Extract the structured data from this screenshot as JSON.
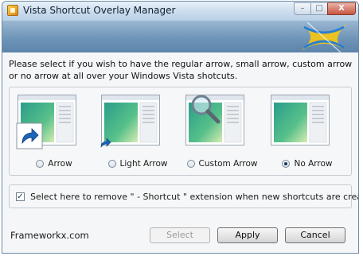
{
  "window": {
    "title": "Vista Shortcut Overlay Manager",
    "controls": {
      "minimize": "–",
      "maximize": "□",
      "close": "X"
    }
  },
  "prompt": "Please select if you wish to have the regular arrow, small arrow, custom arrow or no arrow at all over your Windows Vista shotcuts.",
  "options": [
    {
      "label": "Arrow",
      "selected": false,
      "overlay": "large-arrow-icon"
    },
    {
      "label": "Light Arrow",
      "selected": false,
      "overlay": "small-arrow-icon"
    },
    {
      "label": "Custom Arrow",
      "selected": false,
      "overlay": "magnifier-icon"
    },
    {
      "label": "No Arrow",
      "selected": true,
      "overlay": "none"
    }
  ],
  "remove_extension": {
    "checked": true,
    "label": "Select here to remove \" - Shortcut \" extension when new shortcuts are created."
  },
  "footer": {
    "link": "Frameworkx.com"
  },
  "buttons": {
    "select": {
      "label": "Select",
      "enabled": false
    },
    "apply": {
      "label": "Apply",
      "enabled": true
    },
    "cancel": {
      "label": "Cancel",
      "enabled": true
    }
  },
  "colors": {
    "banner": "#6f95b8",
    "logo_yellow": "#f0c419",
    "logo_blue": "#2a7fd0",
    "thumb_green": "#1f8a7a"
  }
}
